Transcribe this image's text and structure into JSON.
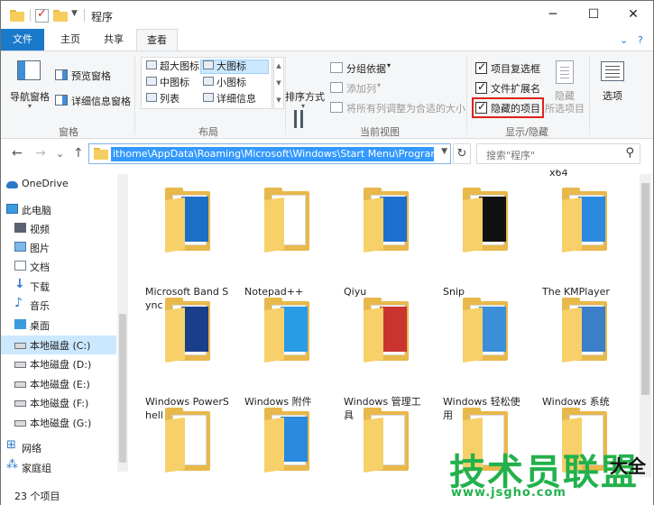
{
  "window": {
    "title": "程序",
    "minimize": "─",
    "maximize": "☐",
    "close": "✕"
  },
  "tabs": [
    {
      "label": "文件"
    },
    {
      "label": "主页"
    },
    {
      "label": "共享"
    },
    {
      "label": "查看"
    }
  ],
  "ribbon_right": {
    "chevron": "⌄",
    "help": "?"
  },
  "ribbon": {
    "panes": {
      "nav_pane": "导航窗格",
      "preview_pane": "预览窗格",
      "details_pane": "详细信息窗格",
      "group": "窗格"
    },
    "layout": {
      "items": [
        "超大图标",
        "大图标",
        "中图标",
        "小图标",
        "列表",
        "详细信息"
      ],
      "selected": "大图标",
      "group": "布局"
    },
    "current_view": {
      "sort": "排序方式",
      "group_by": "分组依据",
      "add_columns": "添加列",
      "fit_columns": "将所有列调整为合适的大小",
      "group": "当前视图"
    },
    "show_hide": {
      "item_checkboxes": "项目复选框",
      "file_extensions": "文件扩展名",
      "hidden_items": "隐藏的项目",
      "hide": "隐藏",
      "hide_selected": "所选项目",
      "options": "选项",
      "group": "显示/隐藏"
    }
  },
  "address": {
    "path": "ithome\\AppData\\Roaming\\Microsoft\\Windows\\Start Menu\\Programs",
    "refresh": "↻"
  },
  "search": {
    "placeholder": "搜索\"程序\"",
    "icon": "search-icon"
  },
  "nav_buttons": {
    "back": "←",
    "forward": "→",
    "recent": "⌄",
    "up": "↑"
  },
  "nav_pane": {
    "items": [
      {
        "label": "OneDrive",
        "icon": "cloud-icon"
      },
      {
        "label": "此电脑",
        "icon": "computer-icon"
      },
      {
        "label": "视频",
        "icon": "video-icon"
      },
      {
        "label": "图片",
        "icon": "picture-icon"
      },
      {
        "label": "文档",
        "icon": "document-icon"
      },
      {
        "label": "下载",
        "icon": "download-icon"
      },
      {
        "label": "音乐",
        "icon": "music-icon"
      },
      {
        "label": "桌面",
        "icon": "desktop-icon"
      },
      {
        "label": "本地磁盘 (C:)",
        "icon": "drive-icon",
        "selected": true
      },
      {
        "label": "本地磁盘 (D:)",
        "icon": "drive-icon"
      },
      {
        "label": "本地磁盘 (E:)",
        "icon": "drive-icon"
      },
      {
        "label": "本地磁盘 (F:)",
        "icon": "drive-icon"
      },
      {
        "label": "本地磁盘 (G:)",
        "icon": "drive-icon"
      },
      {
        "label": "网络",
        "icon": "network-icon"
      },
      {
        "label": "家庭组",
        "icon": "homegroup-icon"
      }
    ]
  },
  "content": {
    "top_label": "x64",
    "folders": [
      {
        "name": "Microsoft Band Sync",
        "art": "#1b6fc4"
      },
      {
        "name": "Notepad++",
        "art": ""
      },
      {
        "name": "Qiyu",
        "art": "#1f6fd1"
      },
      {
        "name": "Snip",
        "art": "#111111"
      },
      {
        "name": "The KMPlayer",
        "art": "#2a8ae0"
      },
      {
        "name": "Windows PowerShell",
        "art": "#1a3f8a"
      },
      {
        "name": "Windows 附件",
        "art": "#2a9be6"
      },
      {
        "name": "Windows 管理工具",
        "art": "#c9342f"
      },
      {
        "name": "Windows 轻松使用",
        "art": "#3a8fd8"
      },
      {
        "name": "Windows 系统",
        "art": "#3a7fc8"
      },
      {
        "name": "",
        "art": ""
      },
      {
        "name": "",
        "art": "#2a8ae0"
      },
      {
        "name": "",
        "art": ""
      },
      {
        "name": "",
        "art": ""
      },
      {
        "name": "",
        "art": ""
      }
    ]
  },
  "status": {
    "count": "23 个项目"
  },
  "watermark": {
    "line1": "技术员联盟",
    "line2": "www.jsgho.com",
    "suffix": "大全"
  },
  "colors": {
    "accent": "#1979ca",
    "highlight_box": "#e02020",
    "selection": "#cce8ff"
  }
}
